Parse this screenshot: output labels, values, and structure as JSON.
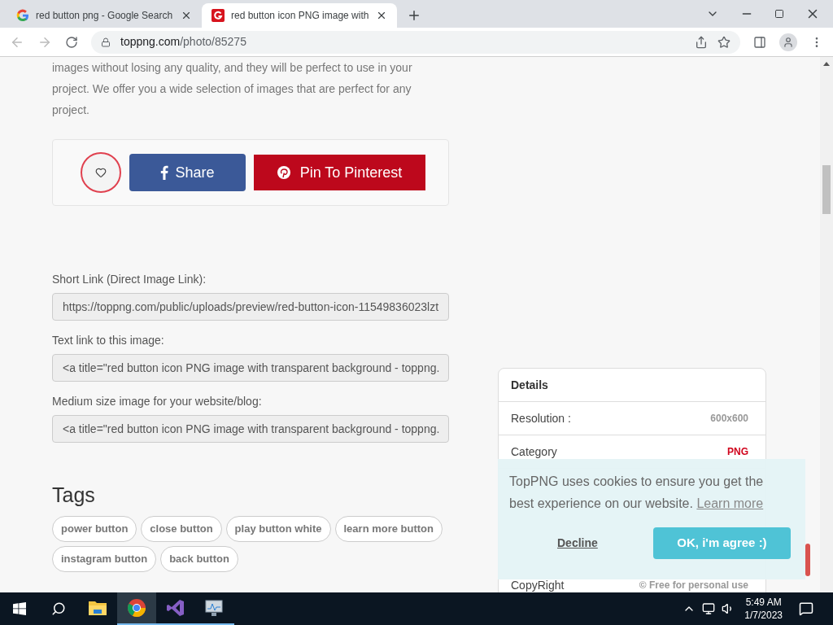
{
  "browser": {
    "tabs": [
      {
        "kind": "google",
        "title": "red button png - Google Search",
        "selected": false
      },
      {
        "kind": "site",
        "title": "red button icon PNG image with",
        "selected": true
      }
    ],
    "address": {
      "host": "toppng.com",
      "path": "/photo/85275"
    }
  },
  "page": {
    "intro": "images without losing any quality, and they will be perfect to use in your project. We offer you a wide selection of images that are perfect for any project.",
    "share": {
      "liked": false,
      "facebook": "Share",
      "pinterest": "Pin To Pinterest"
    },
    "link_fields": [
      {
        "label": "Short Link (Direct Image Link):",
        "value": "https://toppng.com/public/uploads/preview/red-button-icon-11549836023lzt"
      },
      {
        "label": "Text link to this image:",
        "value": "<a title=\"red button icon PNG image with transparent background - toppng."
      },
      {
        "label": "Medium size image for your website/blog:",
        "value": "<a title=\"red button icon PNG image with transparent background - toppng."
      }
    ],
    "tags_heading": "Tags",
    "tags": [
      "power button",
      "close button",
      "play button white",
      "learn more button",
      "instagram button",
      "back button"
    ],
    "details": {
      "heading": "Details",
      "rows": [
        {
          "label": "Resolution :",
          "value": "600x600",
          "kind": "plain"
        },
        {
          "label": "Category",
          "value": "PNG",
          "kind": "accent"
        },
        {
          "label": "CopyRight",
          "value": "© Free for personal use",
          "kind": "plain"
        }
      ]
    },
    "cookie": {
      "message": "TopPNG uses cookies to ensure you get the best experience on our website.",
      "link": "Learn more",
      "decline": "Decline",
      "accept": "OK, i'm agree :)"
    }
  },
  "taskbar": {
    "apps": [
      {
        "kind": "explorer",
        "selected": false,
        "running": false
      },
      {
        "kind": "chrome",
        "selected": true,
        "running": true
      },
      {
        "kind": "studio",
        "selected": false,
        "running": true
      },
      {
        "kind": "monitor",
        "selected": false,
        "running": true
      }
    ],
    "time": "5:49 AM",
    "date": "1/7/2023"
  }
}
